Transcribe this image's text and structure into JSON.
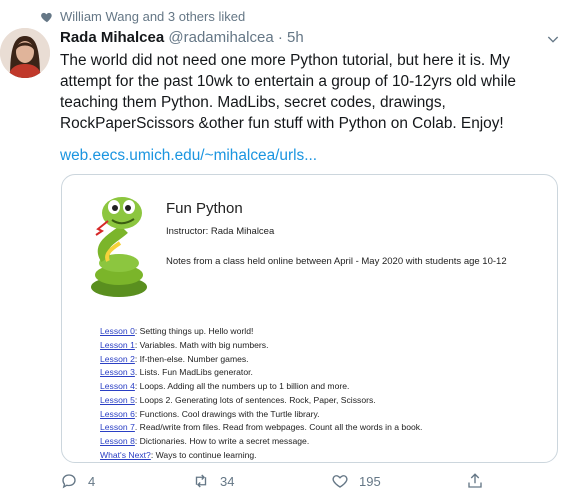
{
  "social_context": {
    "text": "William Wang and 3 others liked"
  },
  "tweet": {
    "author_name": "Rada Mihalcea",
    "handle": "@radamihalcea",
    "separator": "·",
    "time": "5h",
    "text": "The world did not need one more Python tutorial, but here it is. My attempt for the past 10wk to entertain a group of 10-12yrs old while teaching them Python. MadLibs, secret codes, drawings, RockPaperScissors &other fun stuff with Python on Colab. Enjoy!",
    "link": "web.eecs.umich.edu/~mihalcea/urls..."
  },
  "card": {
    "title": "Fun Python",
    "instructor": "Instructor: Rada Mihalcea",
    "notes": "Notes from a class held online between April - May 2020 with students age 10-12",
    "lessons": [
      {
        "link": "Lesson 0",
        "desc": ": Setting things up. Hello world!"
      },
      {
        "link": "Lesson 1",
        "desc": ": Variables. Math with big numbers."
      },
      {
        "link": "Lesson 2",
        "desc": ": If-then-else. Number games."
      },
      {
        "link": "Lesson 3",
        "desc": ". Lists. Fun MadLibs generator."
      },
      {
        "link": "Lesson 4",
        "desc": ": Loops. Adding all the numbers up to 1 billion and more."
      },
      {
        "link": "Lesson 5",
        "desc": ": Loops 2. Generating lots of sentences. Rock, Paper, Scissors."
      },
      {
        "link": "Lesson 6",
        "desc": ": Functions.  Cool drawings with the Turtle library."
      },
      {
        "link": "Lesson 7",
        "desc": ". Read/write from files. Read from webpages. Count all the words in a book."
      },
      {
        "link": "Lesson 8",
        "desc": ": Dictionaries. How to write a secret message."
      },
      {
        "link": "What's Next?",
        "desc": ": Ways to continue learning."
      }
    ]
  },
  "actions": {
    "reply_count": "4",
    "retweet_count": "34",
    "like_count": "195"
  },
  "icons": {
    "social_context": "heart-icon",
    "menu": "chevron-down-icon",
    "reply": "reply-icon",
    "retweet": "retweet-icon",
    "like": "like-icon",
    "share": "share-icon"
  },
  "colors": {
    "link": "#1b95e0",
    "secondary_text": "#657786",
    "lesson_link": "#2a3fc4"
  }
}
